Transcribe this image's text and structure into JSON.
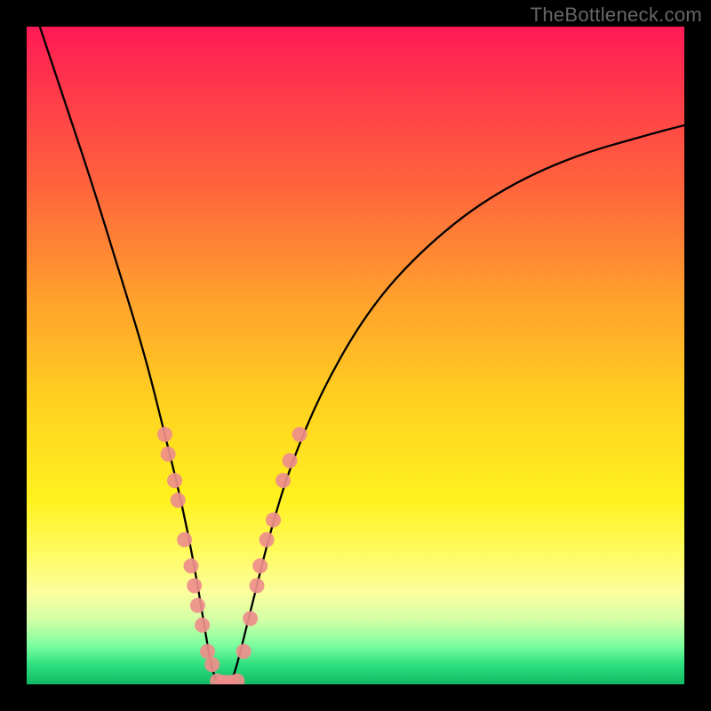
{
  "watermark": "TheBottleneck.com",
  "chart_data": {
    "type": "line",
    "title": "",
    "xlabel": "",
    "ylabel": "",
    "xlim": [
      0,
      100
    ],
    "ylim": [
      0,
      100
    ],
    "grid": false,
    "legend": false,
    "background_gradient": [
      {
        "stop": 0,
        "color": "#ff1a55"
      },
      {
        "stop": 10,
        "color": "#ff3a4a"
      },
      {
        "stop": 24,
        "color": "#ff633d"
      },
      {
        "stop": 42,
        "color": "#ffa32c"
      },
      {
        "stop": 58,
        "color": "#ffd41f"
      },
      {
        "stop": 72,
        "color": "#fff120"
      },
      {
        "stop": 80,
        "color": "#fffb60"
      },
      {
        "stop": 86,
        "color": "#fcff9e"
      },
      {
        "stop": 90,
        "color": "#d6ffa6"
      },
      {
        "stop": 94,
        "color": "#7effa0"
      },
      {
        "stop": 97,
        "color": "#2fe07f"
      },
      {
        "stop": 100,
        "color": "#12b864"
      }
    ],
    "series": [
      {
        "name": "bottleneck-curve",
        "color": "#000000",
        "x": [
          2,
          6,
          10,
          14,
          18,
          21,
          23.5,
          25.5,
          27,
          28,
          29,
          30,
          31,
          32,
          33,
          35,
          37,
          40,
          45,
          52,
          60,
          70,
          82,
          96,
          100
        ],
        "y": [
          100,
          88,
          76,
          63,
          50,
          38,
          28,
          18,
          9,
          3,
          0,
          0,
          0,
          3,
          7,
          15,
          23,
          33,
          45,
          57,
          66,
          74,
          80,
          84,
          85
        ]
      }
    ],
    "markers": [
      {
        "name": "dots-left-branch",
        "color": "#ee8e8b",
        "points": [
          {
            "x": 21.0,
            "y": 38
          },
          {
            "x": 21.5,
            "y": 35
          },
          {
            "x": 22.5,
            "y": 31
          },
          {
            "x": 23.0,
            "y": 28
          },
          {
            "x": 24.0,
            "y": 22
          },
          {
            "x": 25.0,
            "y": 18
          },
          {
            "x": 25.5,
            "y": 15
          },
          {
            "x": 26.0,
            "y": 12
          },
          {
            "x": 26.7,
            "y": 9
          },
          {
            "x": 27.5,
            "y": 5
          },
          {
            "x": 28.2,
            "y": 3
          }
        ]
      },
      {
        "name": "dots-bottom-flat",
        "color": "#ee8e8b",
        "points": [
          {
            "x": 29.0,
            "y": 0.5
          },
          {
            "x": 30.0,
            "y": 0.3
          },
          {
            "x": 31.0,
            "y": 0.3
          },
          {
            "x": 32.0,
            "y": 0.5
          }
        ]
      },
      {
        "name": "dots-right-branch",
        "color": "#ee8e8b",
        "points": [
          {
            "x": 33.0,
            "y": 5
          },
          {
            "x": 34.0,
            "y": 10
          },
          {
            "x": 35.0,
            "y": 15
          },
          {
            "x": 35.5,
            "y": 18
          },
          {
            "x": 36.5,
            "y": 22
          },
          {
            "x": 37.5,
            "y": 25
          },
          {
            "x": 39.0,
            "y": 31
          },
          {
            "x": 40.0,
            "y": 34
          },
          {
            "x": 41.5,
            "y": 38
          }
        ]
      }
    ]
  }
}
